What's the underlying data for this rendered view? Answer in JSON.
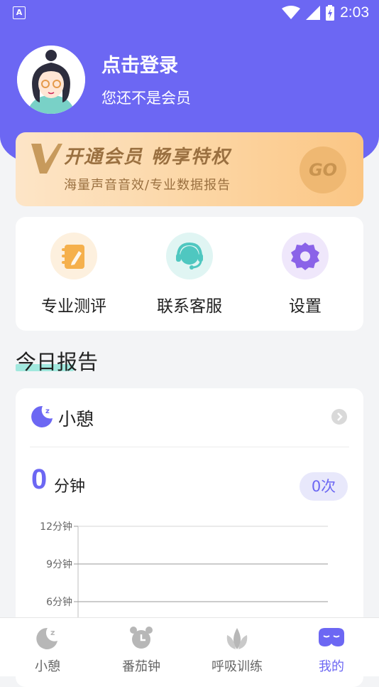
{
  "status_bar": {
    "time": "2:03",
    "notification": "A"
  },
  "profile": {
    "login_title": "点击登录",
    "subtitle": "您还不是会员"
  },
  "vip_banner": {
    "logo": "V",
    "title": "开通会员  畅享特权",
    "subtitle": "海量声音音效/专业数据报告",
    "go_label": "GO"
  },
  "quick_actions": [
    {
      "label": "专业测评",
      "icon": "notebook-icon",
      "color": "#f5b04c"
    },
    {
      "label": "联系客服",
      "icon": "headset-icon",
      "color": "#4fc7c0"
    },
    {
      "label": "设置",
      "icon": "gear-icon",
      "color": "#8a63e8"
    }
  ],
  "report": {
    "section_title": "今日报告"
  },
  "nap_card": {
    "title": "小憩",
    "value": "0",
    "unit": "分钟",
    "count": "0次"
  },
  "chart_data": {
    "type": "bar",
    "categories": [],
    "values": [],
    "y_ticks": [
      "12分钟",
      "9分钟",
      "6分钟"
    ],
    "ylim": [
      0,
      12
    ],
    "grid": true
  },
  "tab_bar": [
    {
      "label": "小憩",
      "icon": "moon-icon",
      "active": false
    },
    {
      "label": "番茄钟",
      "icon": "alarm-clock-icon",
      "active": false
    },
    {
      "label": "呼吸训练",
      "icon": "leaf-icon",
      "active": false
    },
    {
      "label": "我的",
      "icon": "sleep-mask-icon",
      "active": true
    }
  ],
  "colors": {
    "primary": "#6c67f3",
    "vip_text": "#9a7040",
    "accent_underline": "#7ee3d4"
  }
}
